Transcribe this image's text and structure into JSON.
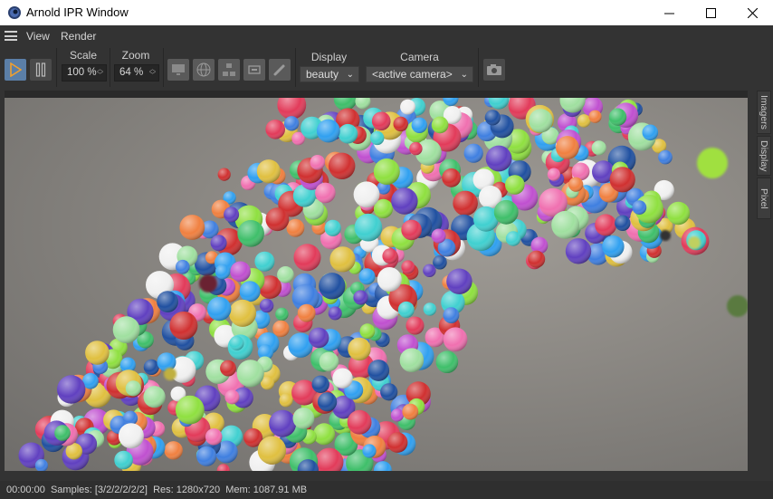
{
  "window": {
    "title": "Arnold IPR Window"
  },
  "menu": {
    "items": [
      "View",
      "Render"
    ]
  },
  "toolbar": {
    "scale_label": "Scale",
    "scale_value": "100 %",
    "zoom_label": "Zoom",
    "zoom_value": "64 %",
    "display_label": "Display",
    "display_value": "beauty",
    "camera_label": "Camera",
    "camera_value": "<active camera>"
  },
  "side_tabs": [
    "Imagers",
    "Display",
    "Pixel"
  ],
  "status": {
    "time": "00:00:00",
    "samples": "Samples: [3/2/2/2/2/2]",
    "resolution": "Res: 1280x720",
    "memory": "Mem: 1087.91 MB"
  },
  "colors": {
    "accent_play": "#f0a030",
    "toolbar_bg": "#333333",
    "render_bg": "#888888"
  }
}
